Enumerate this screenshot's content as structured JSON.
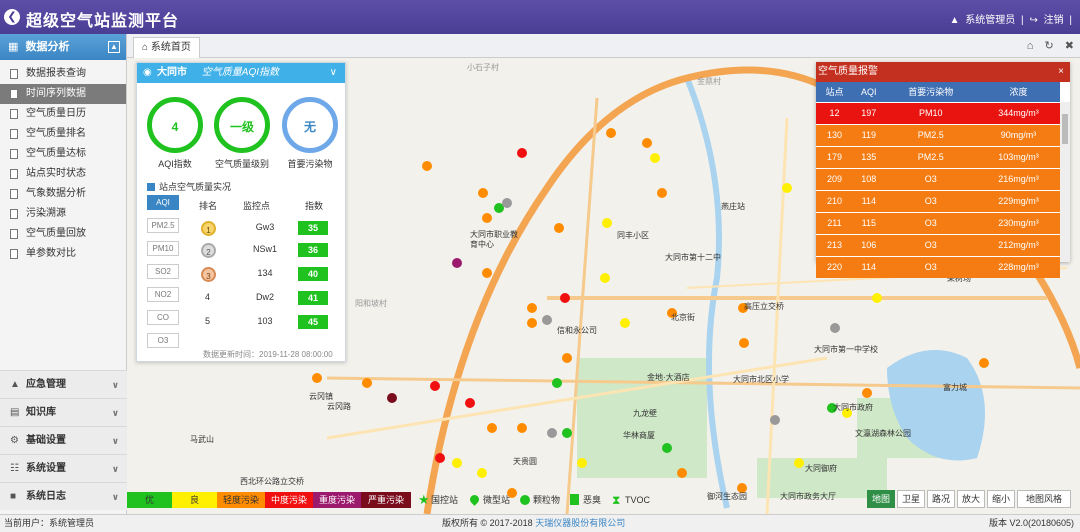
{
  "header": {
    "title": "超级空气站监测平台",
    "user": "系统管理员",
    "separator": "|",
    "logout": "注销",
    "trail": "|"
  },
  "sidebar": {
    "section_title": "数据分析",
    "items": [
      {
        "label": "数据报表查询"
      },
      {
        "label": "时间序列数据"
      },
      {
        "label": "空气质量日历"
      },
      {
        "label": "空气质量排名"
      },
      {
        "label": "空气质量达标"
      },
      {
        "label": "站点实时状态"
      },
      {
        "label": "气象数据分析"
      },
      {
        "label": "污染溯源"
      },
      {
        "label": "空气质量回放"
      },
      {
        "label": "单参数对比"
      }
    ],
    "groups": [
      {
        "label": "应急管理"
      },
      {
        "label": "知识库"
      },
      {
        "label": "基础设置"
      },
      {
        "label": "系统设置"
      },
      {
        "label": "系统日志"
      }
    ]
  },
  "tabs": {
    "home": "系统首页"
  },
  "aqi_panel": {
    "city": "大同市",
    "subtitle": "空气质量AQI指数",
    "aqi_value": "4",
    "aqi_label": "AQI指数",
    "level_value": "一级",
    "level_label": "空气质量级别",
    "primary_value": "无",
    "primary_label": "首要污染物",
    "realtime_title": "站点空气质量实况",
    "pollutant_buttons": [
      "AQI",
      "PM2.5",
      "PM10",
      "SO2",
      "NO2",
      "CO",
      "O3"
    ],
    "col_rank": "排名",
    "col_site": "监控点",
    "col_index": "指数",
    "rows": [
      {
        "rank": "1",
        "site": "Gw3",
        "index": "35"
      },
      {
        "rank": "2",
        "site": "NSw1",
        "index": "36"
      },
      {
        "rank": "3",
        "site": "134",
        "index": "40"
      },
      {
        "rank": "4",
        "site": "Dw2",
        "index": "41"
      },
      {
        "rank": "5",
        "site": "103",
        "index": "45"
      }
    ],
    "update_time": "数据更新时间：2019-11-28 08:00:00"
  },
  "report": {
    "title": "空气质量报警",
    "close": "×",
    "headers": [
      "站点",
      "AQI",
      "首要污染物",
      "浓度"
    ],
    "rows": [
      {
        "site": "12",
        "aqi": "197",
        "pollutant": "PM10",
        "conc": "344mg/m³",
        "level": "red"
      },
      {
        "site": "130",
        "aqi": "119",
        "pollutant": "PM2.5",
        "conc": "90mg/m³",
        "level": "orange"
      },
      {
        "site": "179",
        "aqi": "135",
        "pollutant": "PM2.5",
        "conc": "103mg/m³",
        "level": "orange"
      },
      {
        "site": "209",
        "aqi": "108",
        "pollutant": "O3",
        "conc": "216mg/m³",
        "level": "orange"
      },
      {
        "site": "210",
        "aqi": "114",
        "pollutant": "O3",
        "conc": "229mg/m³",
        "level": "orange"
      },
      {
        "site": "211",
        "aqi": "115",
        "pollutant": "O3",
        "conc": "230mg/m³",
        "level": "orange"
      },
      {
        "site": "213",
        "aqi": "106",
        "pollutant": "O3",
        "conc": "212mg/m³",
        "level": "orange"
      },
      {
        "site": "220",
        "aqi": "114",
        "pollutant": "O3",
        "conc": "228mg/m³",
        "level": "orange"
      }
    ]
  },
  "legend": {
    "levels": [
      {
        "label": "优",
        "color": "#1fc21f"
      },
      {
        "label": "良",
        "color": "#ffef00"
      },
      {
        "label": "轻度污染",
        "color": "#ff8c00"
      },
      {
        "label": "中度污染",
        "color": "#f01010"
      },
      {
        "label": "重度污染",
        "color": "#9b1a6e"
      },
      {
        "label": "严重污染",
        "color": "#7a0c1c"
      }
    ],
    "types": [
      {
        "label": "国控站",
        "icon": "star-icon"
      },
      {
        "label": "微型站",
        "icon": "pin-icon"
      },
      {
        "label": "颗粒物",
        "icon": "drop-icon"
      },
      {
        "label": "恶臭",
        "icon": "cup-icon"
      },
      {
        "label": "TVOC",
        "icon": "hourglass-icon"
      }
    ]
  },
  "map_buttons": [
    "地图",
    "卫星",
    "路况",
    "放大",
    "缩小",
    "地图风格"
  ],
  "map_places": {
    "p1": "大同市职业教育中心",
    "p2": "同丰小区",
    "p3": "信和永公司",
    "p4": "大同市第十二中",
    "p5": "大同市第一中学校",
    "p6": "文瀛湖森林公园",
    "p7": "富力城",
    "p8": "马武山",
    "p9": "云冈路",
    "p10": "西北环公路立交桥",
    "p11": "天贵圆",
    "p12": "华林商厦",
    "p13": "九龙壁",
    "p14": "金地·大酒店",
    "p15": "大同市政府",
    "p16": "大同御府",
    "p17": "大同市政务大厅",
    "p18": "御河生态园",
    "p19": "高压立交桥",
    "p20": "大同市北区小学",
    "p21": "北京街",
    "p22": "燕庄站",
    "p23": "云冈镇",
    "p24": "小石子村",
    "p25": "金鼎村",
    "p26": "果树场",
    "p27": "阳和坡村"
  },
  "footer": {
    "user": "当前用户：系统管理员",
    "copyright": "版权所有 © 2017-2018",
    "company": "天瑞仪器股份有限公司",
    "version": "版本 V2.0(20180605)"
  }
}
